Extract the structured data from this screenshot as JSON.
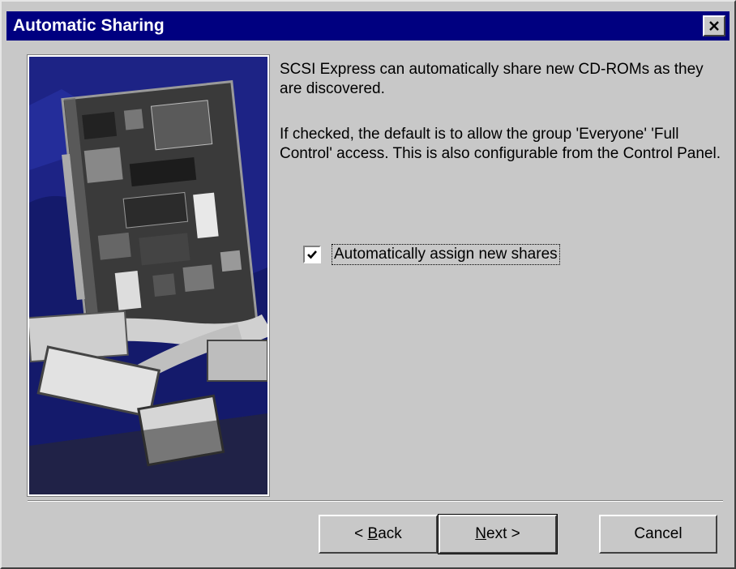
{
  "window": {
    "title": "Automatic Sharing"
  },
  "description": {
    "line1": "SCSI Express can automatically share new CD-ROMs as they are discovered.",
    "line2": "If checked, the default is to allow the group 'Everyone' 'Full Control' access.  This is also configurable from the Control Panel."
  },
  "checkbox": {
    "label": "Automatically assign new shares",
    "checked": true
  },
  "buttons": {
    "back_prefix": "< ",
    "back_accel": "B",
    "back_rest": "ack",
    "next_accel": "N",
    "next_rest": "ext >",
    "cancel": "Cancel"
  },
  "icons": {
    "close": "close-icon",
    "check": "check-icon",
    "photo": "scsi-card-photo"
  },
  "colors": {
    "titlebar": "#000080",
    "dialog_bg": "#c8c8c8"
  }
}
